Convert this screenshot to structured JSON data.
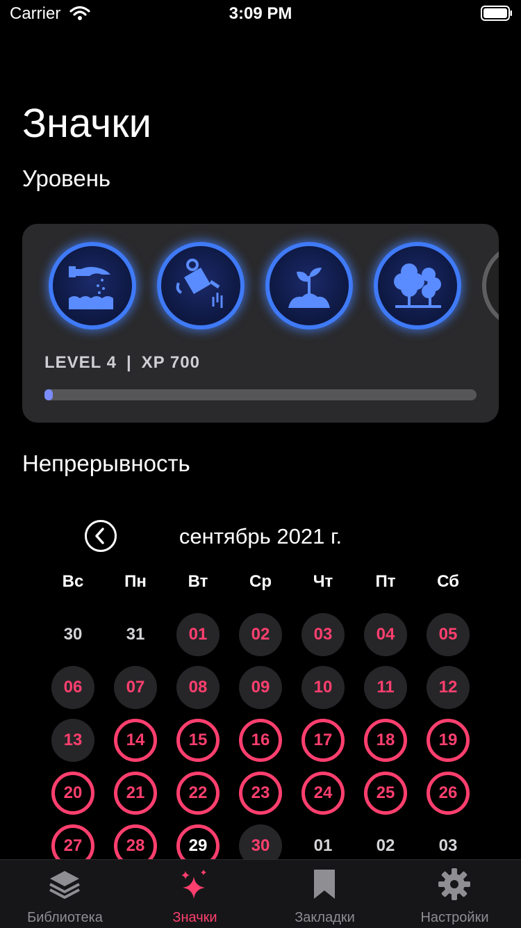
{
  "status_bar": {
    "carrier": "Carrier",
    "time": "3:09 PM"
  },
  "page": {
    "title": "Значки"
  },
  "level_section": {
    "label": "Уровень",
    "level_text": "LEVEL 4",
    "separator": "|",
    "xp_text": "XP 700",
    "xp_progress": 0.02,
    "badges": [
      {
        "icon": "hand-sowing-seeds-icon",
        "state": "earned"
      },
      {
        "icon": "watering-can-icon",
        "state": "earned"
      },
      {
        "icon": "sprout-icon",
        "state": "earned"
      },
      {
        "icon": "trees-icon",
        "state": "earned"
      },
      {
        "icon": "locked-badge-icon",
        "state": "locked"
      }
    ]
  },
  "streak_section": {
    "label": "Непрерывность",
    "month_title": "сентябрь 2021 г.",
    "weekdays": [
      "Вс",
      "Пн",
      "Вт",
      "Ср",
      "Чт",
      "Пт",
      "Сб"
    ],
    "weeks": [
      [
        {
          "t": "30",
          "s": "plain"
        },
        {
          "t": "31",
          "s": "plain"
        },
        {
          "t": "01",
          "s": "filled"
        },
        {
          "t": "02",
          "s": "filled"
        },
        {
          "t": "03",
          "s": "filled"
        },
        {
          "t": "04",
          "s": "filled"
        },
        {
          "t": "05",
          "s": "filled"
        }
      ],
      [
        {
          "t": "06",
          "s": "filled"
        },
        {
          "t": "07",
          "s": "filled"
        },
        {
          "t": "08",
          "s": "filled"
        },
        {
          "t": "09",
          "s": "filled"
        },
        {
          "t": "10",
          "s": "filled"
        },
        {
          "t": "11",
          "s": "filled"
        },
        {
          "t": "12",
          "s": "filled"
        }
      ],
      [
        {
          "t": "13",
          "s": "filled"
        },
        {
          "t": "14",
          "s": "ring"
        },
        {
          "t": "15",
          "s": "ring"
        },
        {
          "t": "16",
          "s": "ring"
        },
        {
          "t": "17",
          "s": "ring"
        },
        {
          "t": "18",
          "s": "ring"
        },
        {
          "t": "19",
          "s": "ring"
        }
      ],
      [
        {
          "t": "20",
          "s": "ring"
        },
        {
          "t": "21",
          "s": "ring"
        },
        {
          "t": "22",
          "s": "ring"
        },
        {
          "t": "23",
          "s": "ring"
        },
        {
          "t": "24",
          "s": "ring"
        },
        {
          "t": "25",
          "s": "ring"
        },
        {
          "t": "26",
          "s": "ring"
        }
      ],
      [
        {
          "t": "27",
          "s": "ring"
        },
        {
          "t": "28",
          "s": "ring"
        },
        {
          "t": "29",
          "s": "today"
        },
        {
          "t": "30",
          "s": "filled"
        },
        {
          "t": "01",
          "s": "plain"
        },
        {
          "t": "02",
          "s": "plain"
        },
        {
          "t": "03",
          "s": "plain"
        }
      ]
    ]
  },
  "tab_bar": {
    "tabs": [
      {
        "label": "Библиотека",
        "icon": "layers-icon",
        "active": false
      },
      {
        "label": "Значки",
        "icon": "sparkles-icon",
        "active": true
      },
      {
        "label": "Закладки",
        "icon": "bookmark-icon",
        "active": false
      },
      {
        "label": "Настройки",
        "icon": "gear-icon",
        "active": false
      }
    ]
  },
  "colors": {
    "accent": "#ff3f6e",
    "badge_ring": "#3f7af7",
    "card_bg": "#2a2a2c",
    "xp_fill": "#7b8cff"
  }
}
